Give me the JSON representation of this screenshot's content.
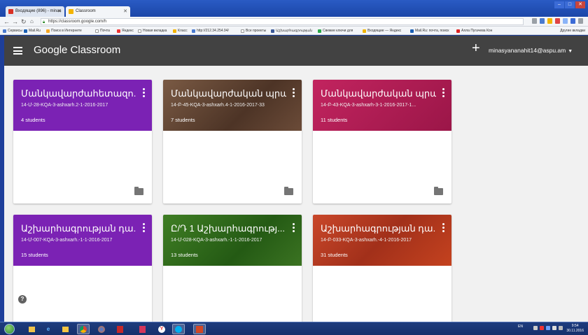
{
  "colors": {
    "appbar": "#424242",
    "card_backgrounds": [
      "#7b22b4",
      "#6b4b38",
      "#b01d55",
      "#7b22b4",
      "#2f6b1c",
      "#b8391f"
    ]
  },
  "browser": {
    "tabs": [
      {
        "label": "Входящие (896) - minas",
        "icon": "gmail-icon",
        "active": false
      },
      {
        "label": "Classroom",
        "icon": "classroom-icon",
        "active": true
      }
    ],
    "url": "https://classroom.google.com/h",
    "bookmarks": [
      "Сервисы",
      "Mail.Ru",
      "Поиск в Интернете",
      "Почта",
      "Яндекс",
      "Новая вкладка",
      "Класс",
      "http://212.34.254.94/",
      "Все проекты",
      "Աշխարհագրության",
      "Свежие ключи для",
      "Входящие — Яндекс",
      "Mail.Ru: почта, поиск",
      "Алла Пугачева Кон"
    ],
    "other_bookmarks": "Другие вкладки"
  },
  "app": {
    "brand": "Google Classroom",
    "account": "minasyananahit14@aspu.am",
    "help": "?"
  },
  "cards": [
    {
      "title": "Մանկավարժահետազո...",
      "section": "14-Մ-28-KQA-3-ashxarh.2-1-2016-2017",
      "students": "4 students"
    },
    {
      "title": "Մանկավարժական պրա...",
      "section": "14-Բ-45-KQA-3-ashxarh.4-1-2016-2017-33",
      "students": "7 students"
    },
    {
      "title": "Մանկավարժական պրա...",
      "section": "14-Բ-43-KQA-3-ashxarh-3-1-2016-2017-1...",
      "students": "11 students"
    },
    {
      "title": "Աշխարհագրության դա...",
      "section": "14-Մ-007-KQA-3-ashxarh.-1-1-2016-2017",
      "students": "15 students"
    },
    {
      "title": "Ը/Դ 1 Աշխարհագրությ...",
      "section": "14-Մ-028-KQA-3-ashxarh.-1-1-2016-2017",
      "students": "13 students"
    },
    {
      "title": "Աշխարհագրության դա...",
      "section": "14-Բ-033-KQA-3-ashxarh.-4-1-2016-2017",
      "students": "31 students"
    }
  ],
  "taskbar": {
    "language": "EN",
    "time": "9:54",
    "date": "30.11.2016"
  }
}
